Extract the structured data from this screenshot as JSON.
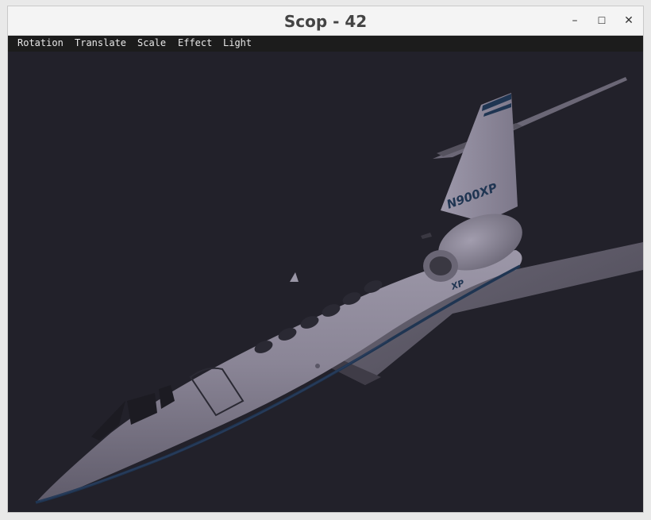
{
  "window": {
    "title": "Scop - 42",
    "controls": {
      "minimize": "–",
      "maximize": "☐",
      "close": "✕"
    }
  },
  "menu": {
    "items": [
      "Rotation",
      "Translate",
      "Scale",
      "Effect",
      "Light"
    ]
  },
  "scene": {
    "background_color": "#22212a",
    "model_color": "#8d8899",
    "stripe_color": "#1f3552",
    "registration": "N900XP",
    "engine_cowl_text": "XP"
  }
}
